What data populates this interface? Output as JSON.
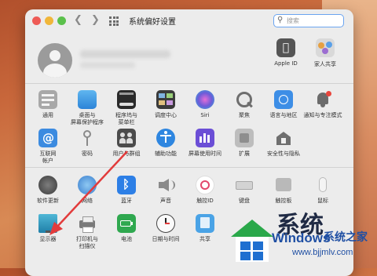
{
  "window": {
    "title": "系统偏好设置",
    "search_placeholder": "搜索"
  },
  "account_items": [
    {
      "label": "Apple ID",
      "icon": "apple-icon"
    },
    {
      "label": "家人共享",
      "icon": "family-sharing-icon"
    }
  ],
  "row1": [
    {
      "label": "通用",
      "icon": "general-icon"
    },
    {
      "label": "桌面与\n屏幕保护程序",
      "icon": "desktop-screensaver-icon"
    },
    {
      "label": "程序坞与\n菜单栏",
      "icon": "dock-menubar-icon"
    },
    {
      "label": "调度中心",
      "icon": "mission-control-icon"
    },
    {
      "label": "Siri",
      "icon": "siri-icon"
    },
    {
      "label": "聚焦",
      "icon": "spotlight-icon"
    },
    {
      "label": "语言与地区",
      "icon": "language-region-icon"
    },
    {
      "label": "通知与专注模式",
      "icon": "notifications-icon"
    }
  ],
  "row2": [
    {
      "label": "互联网\n帐户",
      "icon": "internet-accounts-icon"
    },
    {
      "label": "密码",
      "icon": "passwords-icon"
    },
    {
      "label": "用户与群组",
      "icon": "users-groups-icon"
    },
    {
      "label": "辅助功能",
      "icon": "accessibility-icon"
    },
    {
      "label": "屏幕使用时间",
      "icon": "screen-time-icon"
    },
    {
      "label": "扩展",
      "icon": "extensions-icon"
    },
    {
      "label": "安全性与隐私",
      "icon": "security-privacy-icon"
    }
  ],
  "row3": [
    {
      "label": "软件更新",
      "icon": "software-update-icon"
    },
    {
      "label": "网络",
      "icon": "network-icon"
    },
    {
      "label": "蓝牙",
      "icon": "bluetooth-icon"
    },
    {
      "label": "声音",
      "icon": "sound-icon"
    },
    {
      "label": "触控ID",
      "icon": "touch-id-icon"
    },
    {
      "label": "键盘",
      "icon": "keyboard-icon"
    },
    {
      "label": "触控板",
      "icon": "trackpad-icon"
    },
    {
      "label": "鼠标",
      "icon": "mouse-icon"
    }
  ],
  "row4": [
    {
      "label": "显示器",
      "icon": "displays-icon"
    },
    {
      "label": "打印机与\n扫描仪",
      "icon": "printers-icon"
    },
    {
      "label": "电池",
      "icon": "battery-icon"
    },
    {
      "label": "日期与时间",
      "icon": "date-time-icon"
    },
    {
      "label": "共享",
      "icon": "sharing-icon"
    }
  ],
  "watermark": {
    "brand": "Windows",
    "brand_cn": "系统之家",
    "url": "www.bjjmlv.com",
    "big_text": "系统"
  },
  "colors": {
    "accent_blue": "#2d7fe6",
    "annotation_arrow": "#e23b3b"
  }
}
